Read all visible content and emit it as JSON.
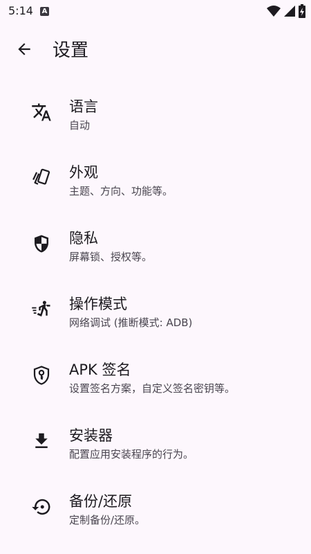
{
  "status_bar": {
    "time": "5:14",
    "notification_badge": "A"
  },
  "app_bar": {
    "title": "设置"
  },
  "settings": [
    {
      "icon": "translate-icon",
      "title": "语言",
      "subtitle": "自动"
    },
    {
      "icon": "appearance-icon",
      "title": "外观",
      "subtitle": "主题、方向、功能等。"
    },
    {
      "icon": "shield-icon",
      "title": "隐私",
      "subtitle": "屏幕锁、授权等。"
    },
    {
      "icon": "running-person-icon",
      "title": "操作模式",
      "subtitle": "网络调试 (推断模式: ADB)"
    },
    {
      "icon": "key-shield-icon",
      "title": "APK 签名",
      "subtitle": "设置签名方案，自定义签名密钥等。"
    },
    {
      "icon": "download-icon",
      "title": "安装器",
      "subtitle": "配置应用安装程序的行为。"
    },
    {
      "icon": "restore-icon",
      "title": "备份/还原",
      "subtitle": "定制备份/还原。"
    }
  ]
}
